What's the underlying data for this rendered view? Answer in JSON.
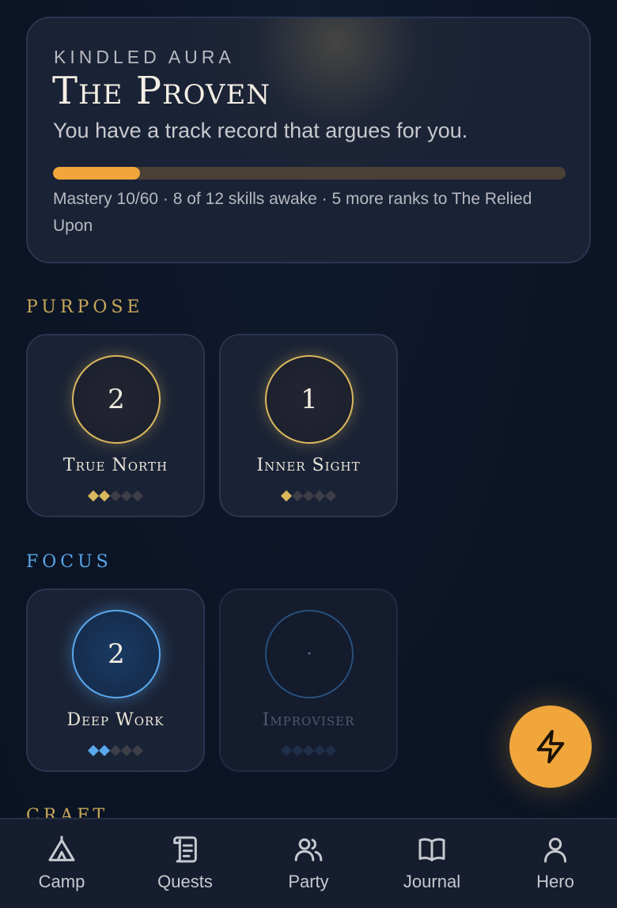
{
  "aura": {
    "eyebrow": "KINDLED AURA",
    "title": "The Proven",
    "subtitle": "You have a track record that argues for you.",
    "progress_fraction": 0.17,
    "meta": "Mastery 10/60 · 8 of 12 skills awake · 5 more ranks to The Relied Upon"
  },
  "sections": {
    "purpose": {
      "title": "PURPOSE",
      "skills": [
        {
          "name": "True North",
          "rank": "2",
          "pips_filled": 2,
          "pips_total": 5
        },
        {
          "name": "Inner Sight",
          "rank": "1",
          "pips_filled": 1,
          "pips_total": 5
        }
      ]
    },
    "focus": {
      "title": "FOCUS",
      "skills": [
        {
          "name": "Deep Work",
          "rank": "2",
          "pips_filled": 2,
          "pips_total": 5
        },
        {
          "name": "Improviser",
          "rank": "·",
          "pips_filled": 0,
          "pips_total": 5
        }
      ]
    },
    "craft": {
      "title": "CRAFT"
    }
  },
  "colors": {
    "gold": "#d9b85e",
    "blue": "#5aa9ee",
    "accent": "#f0a63b",
    "pip_empty": "#3d3f48",
    "pip_locked": "#1f2f48"
  },
  "fab": {
    "icon": "lightning-bolt-icon"
  },
  "nav": [
    {
      "label": "Camp",
      "icon": "tent-icon"
    },
    {
      "label": "Quests",
      "icon": "scroll-icon"
    },
    {
      "label": "Party",
      "icon": "people-icon"
    },
    {
      "label": "Journal",
      "icon": "book-icon"
    },
    {
      "label": "Hero",
      "icon": "person-icon"
    }
  ]
}
